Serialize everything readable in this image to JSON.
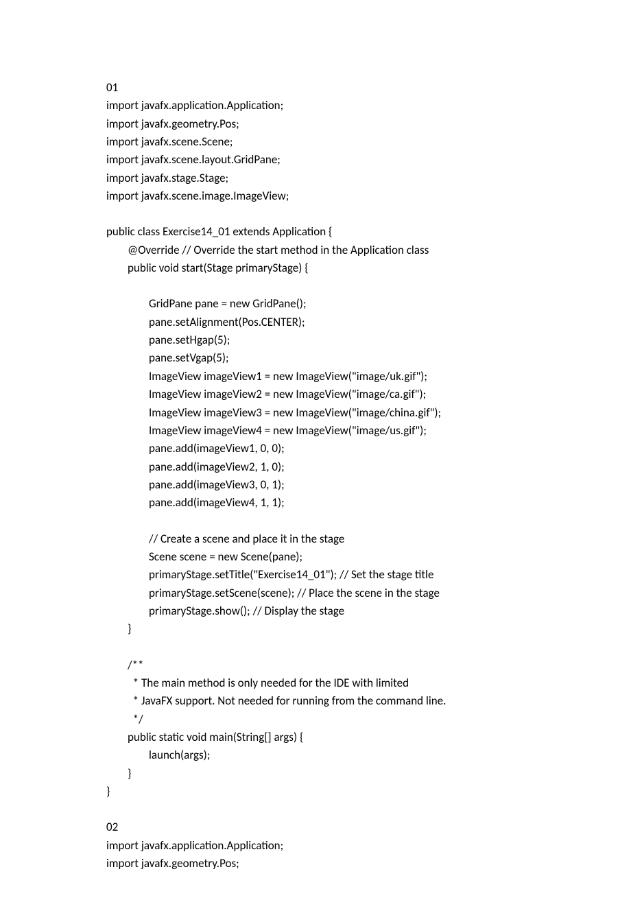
{
  "lines": [
    {
      "indent": 0,
      "text": "01"
    },
    {
      "indent": 0,
      "text": "import javafx.application.Application;"
    },
    {
      "indent": 0,
      "text": "import javafx.geometry.Pos;"
    },
    {
      "indent": 0,
      "text": "import javafx.scene.Scene;"
    },
    {
      "indent": 0,
      "text": "import javafx.scene.layout.GridPane;"
    },
    {
      "indent": 0,
      "text": "import javafx.stage.Stage;"
    },
    {
      "indent": 0,
      "text": "import javafx.scene.image.ImageView;"
    },
    {
      "indent": 0,
      "text": "",
      "blank": true
    },
    {
      "indent": 0,
      "text": "public class Exercise14_01 extends Application {"
    },
    {
      "indent": 1,
      "text": "@Override // Override the start method in the Application class"
    },
    {
      "indent": 1,
      "text": "public void start(Stage primaryStage) {"
    },
    {
      "indent": 0,
      "text": "",
      "blank": true
    },
    {
      "indent": 2,
      "text": "GridPane pane = new GridPane();"
    },
    {
      "indent": 2,
      "text": "pane.setAlignment(Pos.CENTER);"
    },
    {
      "indent": 2,
      "text": "pane.setHgap(5);"
    },
    {
      "indent": 2,
      "text": "pane.setVgap(5);"
    },
    {
      "indent": 2,
      "text": "ImageView imageView1 = new ImageView(\"image/uk.gif\");"
    },
    {
      "indent": 2,
      "text": "ImageView imageView2 = new ImageView(\"image/ca.gif\");"
    },
    {
      "indent": 2,
      "text": "ImageView imageView3 = new ImageView(\"image/china.gif\");"
    },
    {
      "indent": 2,
      "text": "ImageView imageView4 = new ImageView(\"image/us.gif\");"
    },
    {
      "indent": 2,
      "text": "pane.add(imageView1, 0, 0);"
    },
    {
      "indent": 2,
      "text": "pane.add(imageView2, 1, 0);"
    },
    {
      "indent": 2,
      "text": "pane.add(imageView3, 0, 1);"
    },
    {
      "indent": 2,
      "text": "pane.add(imageView4, 1, 1);"
    },
    {
      "indent": 0,
      "text": "",
      "blank": true
    },
    {
      "indent": 2,
      "text": "// Create a scene and place it in the stage"
    },
    {
      "indent": 2,
      "text": "Scene scene = new Scene(pane);"
    },
    {
      "indent": 2,
      "text": "primaryStage.setTitle(\"Exercise14_01\"); // Set the stage title"
    },
    {
      "indent": 2,
      "text": "primaryStage.setScene(scene); // Place the scene in the stage"
    },
    {
      "indent": 2,
      "text": "primaryStage.show(); // Display the stage"
    },
    {
      "indent": 1,
      "text": "}"
    },
    {
      "indent": 0,
      "text": "",
      "blank": true
    },
    {
      "indent": 1,
      "text": "/**"
    },
    {
      "indent": 1,
      "text": "  * The main method is only needed for the IDE with limited"
    },
    {
      "indent": 1,
      "text": "  * JavaFX support. Not needed for running from the command line."
    },
    {
      "indent": 1,
      "text": "  */"
    },
    {
      "indent": 1,
      "text": "public static void main(String[] args) {"
    },
    {
      "indent": 2,
      "text": "launch(args);"
    },
    {
      "indent": 1,
      "text": "}"
    },
    {
      "indent": 0,
      "text": "}"
    },
    {
      "indent": 0,
      "text": "",
      "blank": true
    },
    {
      "indent": 0,
      "text": "02"
    },
    {
      "indent": 0,
      "text": "import javafx.application.Application;"
    },
    {
      "indent": 0,
      "text": "import javafx.geometry.Pos;"
    }
  ]
}
